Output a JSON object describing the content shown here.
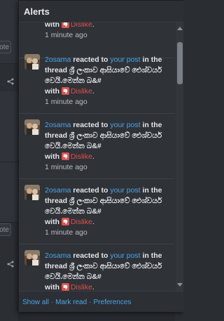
{
  "popup": {
    "title": "Alerts"
  },
  "alert_template": {
    "username": "2osama",
    "reacted_to": "reacted to",
    "your_post": "your post",
    "in_the_thread": "in the thread",
    "thread_title": "ශ්‍රී ලංකාව ආසියාවේ ඓශ්වර්ය වෙයි.මෙන්න බ&#",
    "with": "with",
    "reaction": "Dislike",
    "reaction_icon": "thumbs-down-icon",
    "period": ".",
    "time": "1 minute ago"
  },
  "partial_alert": {
    "with": "with",
    "reaction": "Dislike",
    "period": ".",
    "time": "1 minute ago"
  },
  "footer": {
    "show_all": "Show all",
    "mark_read": "Mark read",
    "preferences": "Preferences",
    "separator": "·"
  },
  "background": {
    "vote_label_1": "ote",
    "vote_label_2": "ote"
  },
  "colors": {
    "accent": "#47a7eb",
    "dislike": "#e0504d",
    "popup_bg": "#2f3237"
  }
}
